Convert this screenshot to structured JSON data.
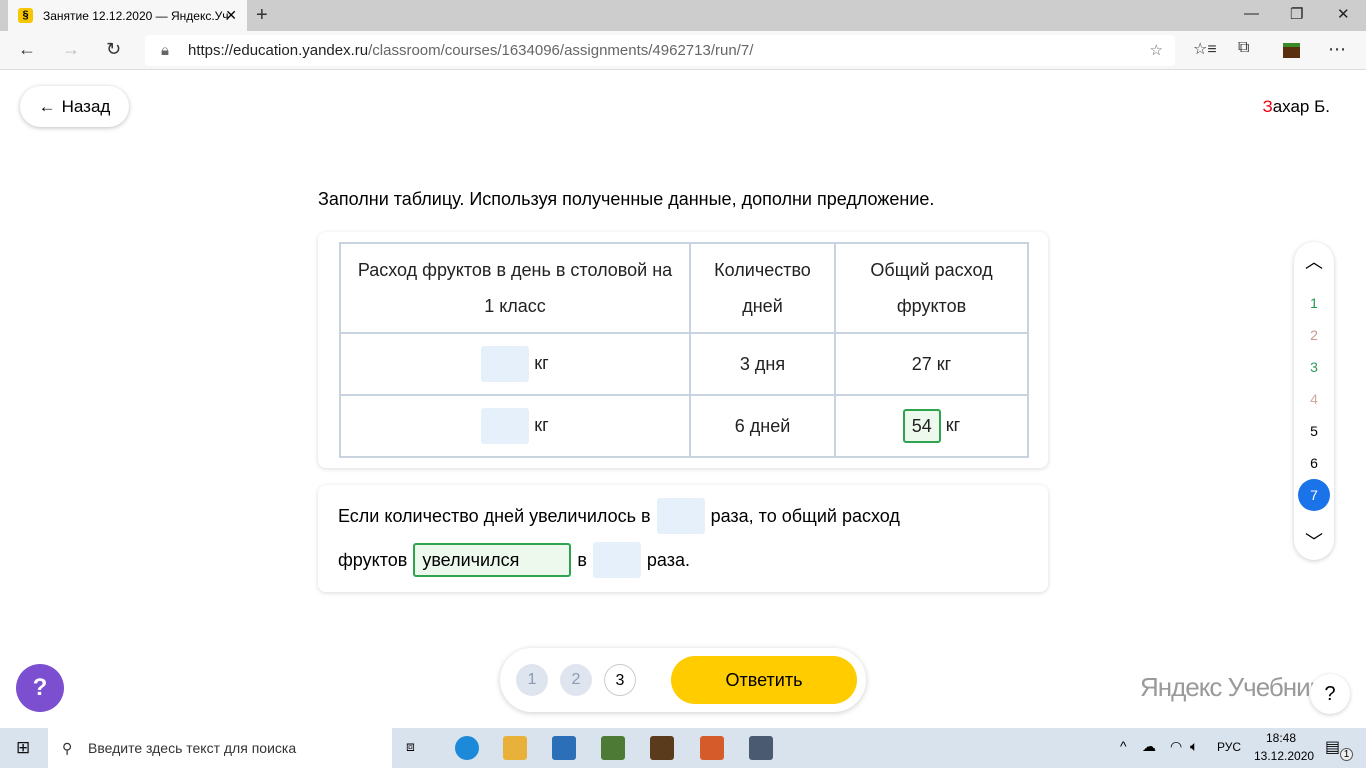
{
  "browser": {
    "tab_title": "Занятие 12.12.2020 — Яндекс.Уч",
    "favicon": "§",
    "url_host": "https://education.yandex.ru",
    "url_path": "/classroom/courses/1634096/assignments/4962713/run/7/"
  },
  "header": {
    "back_label": "Назад",
    "user_initial": "З",
    "user_rest": "ахар Б."
  },
  "task": {
    "title": "Заполни таблицу. Используя полученные данные, дополни предложение.",
    "table": {
      "headers": [
        "Расход фруктов в день в столовой на 1 класс",
        "Количество дней",
        "Общий расход фруктов"
      ],
      "rows": [
        {
          "unit": "кг",
          "days": "3 дня",
          "total": "27 кг"
        },
        {
          "unit": "кг",
          "days": "6 дней",
          "total_value": "54",
          "total_unit": "кг"
        }
      ]
    },
    "sentence": {
      "p1": "Если количество дней увеличилось в",
      "p2": "раза, то общий расход",
      "p3": "фруктов",
      "select_value": "увеличился",
      "p4": "в",
      "p5": "раза."
    }
  },
  "side_nav": {
    "items": [
      "1",
      "2",
      "3",
      "4",
      "5",
      "6",
      "7"
    ],
    "current": "7"
  },
  "bottom": {
    "steps": [
      "1",
      "2",
      "3"
    ],
    "answer_label": "Ответить"
  },
  "help": "?",
  "brand": "Яндекс Учебник",
  "taskbar": {
    "search_placeholder": "Введите здесь текст для поиска",
    "lang": "РУС",
    "time": "18:48",
    "date": "13.12.2020",
    "notifications": "1"
  }
}
